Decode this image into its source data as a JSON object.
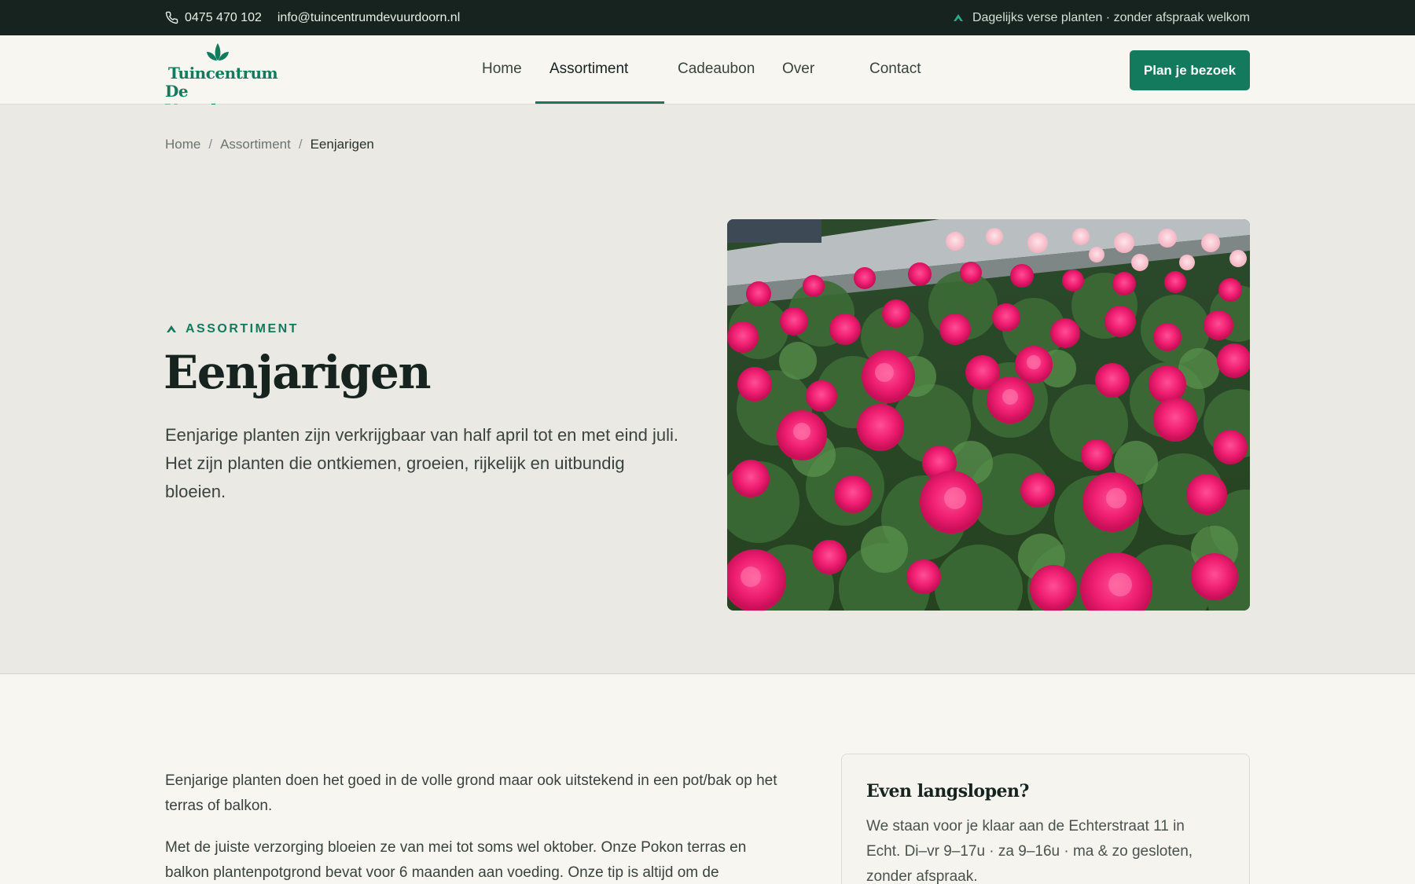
{
  "topbar": {
    "phone": "0475 470 102",
    "email": "info@tuincentrumdevuurdoorn.nl",
    "tagline": "Dagelijks verse planten · zonder afspraak welkom"
  },
  "logo": {
    "line1": "Tuincentrum",
    "line2": "De Vuurdoorn"
  },
  "nav": {
    "home": "Home",
    "assortiment": "Assortiment",
    "cadeaubon": "Cadeaubon",
    "over_ons": "Over ons",
    "contact": "Contact",
    "active": "Assortiment"
  },
  "cta_label": "Plan je bezoek",
  "breadcrumb": {
    "home": "Home",
    "assortiment": "Assortiment",
    "current": "Eenjarigen",
    "separator": "/"
  },
  "hero": {
    "eyebrow": "ASSORTIMENT",
    "title": "Eenjarigen",
    "lead": "Eenjarige planten zijn verkrijgbaar van half april tot en met eind juli. Het zijn planten die ontkiemen, groeien, rijkelijk en uitbundig bloeien."
  },
  "content": {
    "p1": "Eenjarige planten doen het goed in de volle grond maar ook uitstekend in een pot/bak op het terras of balkon.",
    "p2": "Met de juiste verzorging bloeien ze van mei tot soms wel oktober. Onze Pokon terras en balkon plantenpotgrond bevat voor 6 maanden aan voeding. Onze tip is altijd om de"
  },
  "visit_card": {
    "title": "Even langslopen?",
    "text": "We staan voor je klaar aan de Echterstraat 11 in Echt. Di–vr 9–17u · za 9–16u · ma & zo gesloten, zonder afspraak."
  },
  "colors": {
    "brand": "#137a5e",
    "topbar_bg": "#16231e",
    "hero_bg": "#eae9e4",
    "page_bg": "#f7f6f1"
  },
  "icons": {
    "phone": "phone-icon",
    "leaf": "leaf-icon",
    "chevron": "chevron-down-icon"
  }
}
